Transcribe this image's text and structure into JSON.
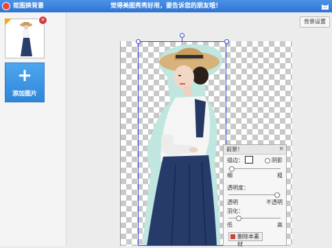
{
  "titlebar": {
    "app_title": "抠图换背景",
    "slogan": "觉得美图秀秀好用，要告诉您的朋友哦！"
  },
  "sidebar": {
    "add_button_label": "添加图片",
    "add_icon_text": "+",
    "thumb_close_text": "×"
  },
  "toolbar": {
    "bg_settings_label": "背景设置"
  },
  "panel": {
    "title": "前景！",
    "close_text": "×",
    "edge_label": "描边：",
    "shadow_label": "阴影",
    "thin_label": "细",
    "thick_label": "粗",
    "opacity_label": "透明度：",
    "transparent_label": "透明",
    "opaque_label": "不透明",
    "feather_label": "羽化：",
    "low_label": "低",
    "high_label": "高",
    "delete_label": "删除本素材"
  },
  "colors": {
    "titlebar": "#3a82dc",
    "selection": "#3d47c9",
    "add_button": "#3a94e2"
  }
}
